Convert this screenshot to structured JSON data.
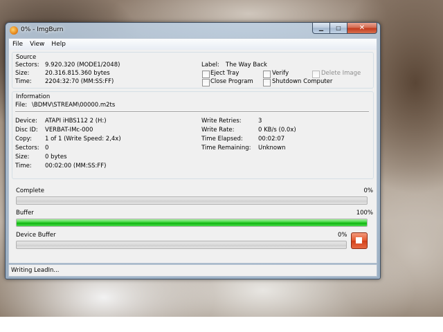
{
  "window": {
    "title": "0% - ImgBurn",
    "minimize_symbol": "▁",
    "maximize_symbol": "□",
    "close_symbol": "✕"
  },
  "menu": [
    "File",
    "View",
    "Help"
  ],
  "source": {
    "group_label": "Source",
    "sectors_label": "Sectors:",
    "sectors_value": "9.920.320 (MODE1/2048)",
    "size_label": "Size:",
    "size_value": "20.316.815.360 bytes",
    "time_label": "Time:",
    "time_value": "2204:32:70 (MM:SS:FF)",
    "disc_label_label": "Label:",
    "disc_label_value": "The Way Back",
    "options": {
      "eject_tray": "Eject Tray",
      "verify": "Verify",
      "delete_image": "Delete Image",
      "close_program": "Close Program",
      "shutdown_computer": "Shutdown Computer"
    }
  },
  "information": {
    "group_label": "Information",
    "file_label": "File:",
    "file_value": "\\BDMV\\STREAM\\00000.m2ts",
    "device_label": "Device:",
    "device_value": "ATAPI iHBS112 2 (H:)",
    "disc_id_label": "Disc ID:",
    "disc_id_value": "VERBAT-IMc-000",
    "copy_label": "Copy:",
    "copy_value": "1 of 1 (Write Speed: 2,4x)",
    "sectors_label": "Sectors:",
    "sectors_value": "0",
    "size_label": "Size:",
    "size_value": "0 bytes",
    "time_label": "Time:",
    "time_value": "00:02:00 (MM:SS:FF)",
    "write_retries_label": "Write Retries:",
    "write_retries_value": "3",
    "write_rate_label": "Write Rate:",
    "write_rate_value": "0 KB/s (0.0x)",
    "time_elapsed_label": "Time Elapsed:",
    "time_elapsed_value": "00:02:07",
    "time_remaining_label": "Time Remaining:",
    "time_remaining_value": "Unknown"
  },
  "progress": {
    "complete_label": "Complete",
    "complete_text": "0%",
    "complete_fraction": 0,
    "buffer_label": "Buffer",
    "buffer_text": "100%",
    "buffer_fraction": 1.0,
    "device_buffer_label": "Device Buffer",
    "device_buffer_text": "0%",
    "device_buffer_fraction": 0,
    "fill_color": "#1fc41f"
  },
  "status": {
    "text": "Writing LeadIn..."
  },
  "icons": {
    "app": "imgburn-flame-icon",
    "stop": "stop-icon"
  }
}
